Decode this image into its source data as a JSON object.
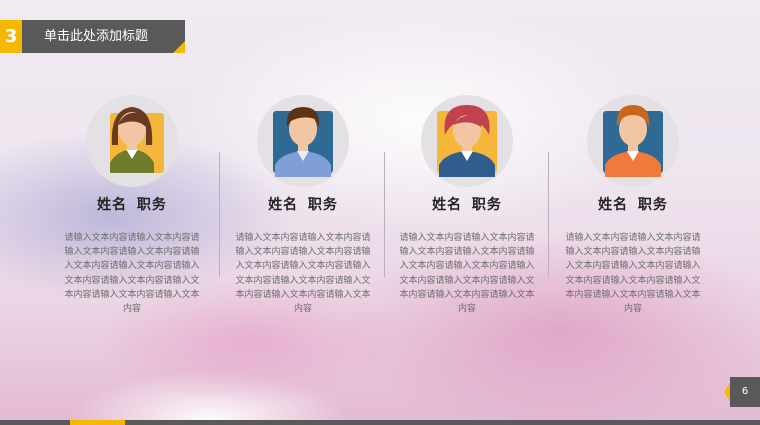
{
  "header": {
    "number": "3",
    "title": "单击此处添加标题"
  },
  "people": [
    {
      "avatar": "female-avatar-icon",
      "name": "姓名  职务",
      "description": "请输入文本内容请输入文本内容请输入文本内容请输入文本内容请输入文本内容请输入文本内容请输入文本内容请输入文本内容请输入文本内容请输入文本内容请输入文本内容"
    },
    {
      "avatar": "male-avatar-icon",
      "name": "姓名  职务",
      "description": "请输入文本内容请输入文本内容请输入文本内容请输入文本内容请输入文本内容请输入文本内容请输入文本内容请输入文本内容请输入文本内容请输入文本内容请输入文本内容"
    },
    {
      "avatar": "female-avatar-icon",
      "name": "姓名  职务",
      "description": "请输入文本内容请输入文本内容请输入文本内容请输入文本内容请输入文本内容请输入文本内容请输入文本内容请输入文本内容请输入文本内容请输入文本内容请输入文本内容"
    },
    {
      "avatar": "male-avatar-icon",
      "name": "姓名  职务",
      "description": "请输入文本内容请输入文本内容请输入文本内容请输入文本内容请输入文本内容请输入文本内容请输入文本内容请输入文本内容请输入文本内容请输入文本内容请输入文本内容"
    }
  ],
  "footer": {
    "page_number": "6"
  },
  "colors": {
    "accent": "#f5b800",
    "dark": "#595959"
  }
}
